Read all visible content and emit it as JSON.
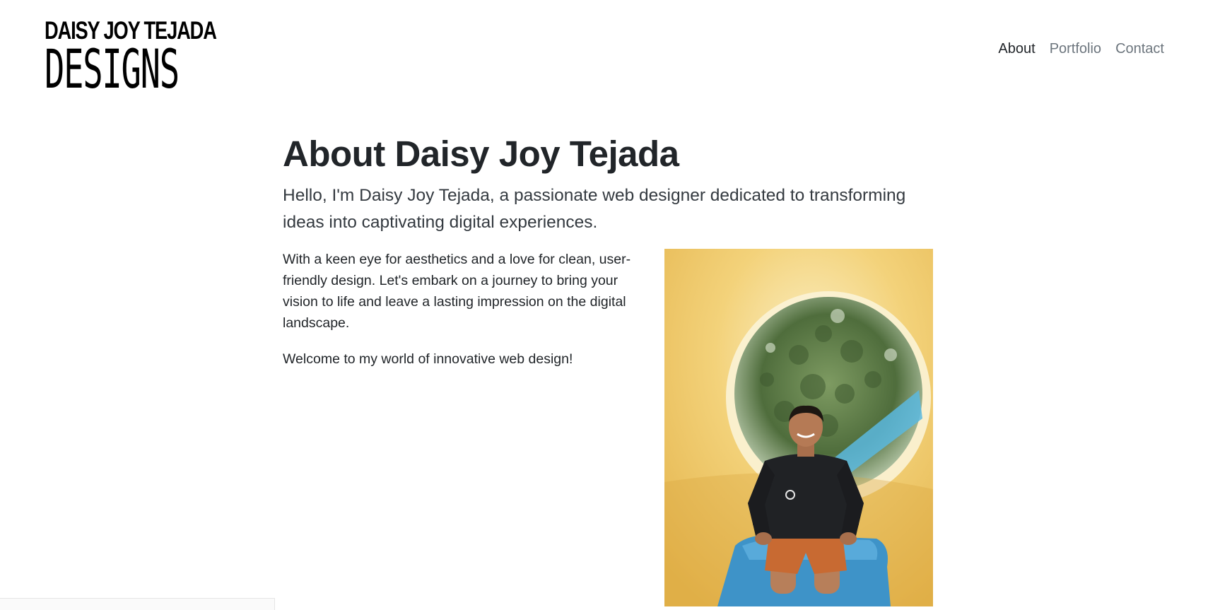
{
  "brand": {
    "line1": "DAISY JOY TEJADA",
    "line2": "DESIGNS"
  },
  "nav": {
    "items": [
      {
        "label": "About",
        "active": true
      },
      {
        "label": "Portfolio",
        "active": false
      },
      {
        "label": "Contact",
        "active": false
      }
    ]
  },
  "about": {
    "title": "About Daisy Joy Tejada",
    "lead": "Hello, I'm Daisy Joy Tejada, a passionate web designer dedicated to transforming ideas into captivating digital experiences.",
    "paragraph1": "With a keen eye for aesthetics and a love for clean, user-friendly design. Let's embark on a journey to bring your vision to life and leave a lasting impression on the digital landscape.",
    "paragraph2": "Welcome to my world of innovative web design!"
  }
}
